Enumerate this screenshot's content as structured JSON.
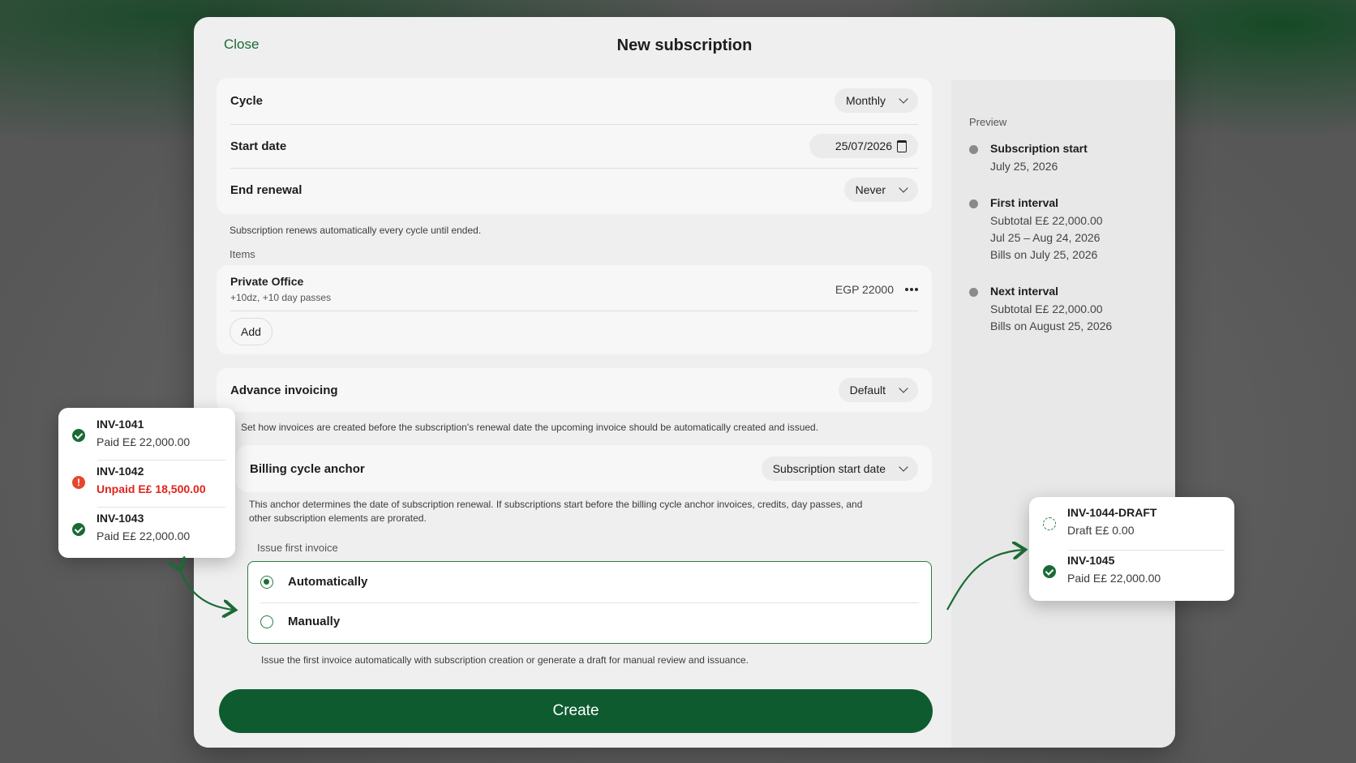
{
  "modal": {
    "close_label": "Close",
    "title": "New subscription"
  },
  "cycle": {
    "label": "Cycle",
    "value": "Monthly"
  },
  "start_date": {
    "label": "Start date",
    "value": "25/07/2026"
  },
  "end_renewal": {
    "label": "End renewal",
    "value": "Never"
  },
  "renewal_helper": "Subscription renews automatically every cycle until ended.",
  "items": {
    "section_label": "Items",
    "list": [
      {
        "name": "Private Office",
        "details": "+10dz, +10 day passes",
        "price": "EGP 22000"
      }
    ],
    "add_label": "Add"
  },
  "advance_invoicing": {
    "label": "Advance invoicing",
    "value": "Default",
    "helper": "Set how invoices are created before the subscription's renewal date the upcoming invoice should be automatically created and issued."
  },
  "billing_anchor": {
    "label": "Billing cycle anchor",
    "value": "Subscription start date",
    "helper": "This anchor determines the date of subscription renewal. If subscriptions start before the billing cycle anchor invoices, credits, day passes, and other subscription elements are prorated."
  },
  "issue_first_invoice": {
    "label": "Issue first invoice",
    "options": [
      "Automatically",
      "Manually"
    ],
    "selected": "Automatically",
    "helper": "Issue the first invoice automatically with subscription creation or generate a draft for manual review and issuance."
  },
  "create_label": "Create",
  "preview": {
    "label": "Preview",
    "timeline": [
      {
        "title": "Subscription start",
        "lines": [
          "July 25, 2026"
        ]
      },
      {
        "title": "First interval",
        "lines": [
          "Subtotal E£ 22,000.00",
          "Jul 25 – Aug 24, 2026",
          "Bills on July 25, 2026"
        ]
      },
      {
        "title": "Next interval",
        "lines": [
          "Subtotal E£ 22,000.00",
          "Bills on August 25, 2026"
        ]
      }
    ]
  },
  "invoices_left": [
    {
      "id": "INV-1041",
      "status": "Paid E£ 22,000.00",
      "state": "paid"
    },
    {
      "id": "INV-1042",
      "status": "Unpaid E£ 18,500.00",
      "state": "unpaid"
    },
    {
      "id": "INV-1043",
      "status": "Paid E£ 22,000.00",
      "state": "paid"
    }
  ],
  "invoices_right": [
    {
      "id": "INV-1044-DRAFT",
      "status": "Draft E£ 0.00",
      "state": "draft"
    },
    {
      "id": "INV-1045",
      "status": "Paid E£ 22,000.00",
      "state": "paid"
    }
  ],
  "colors": {
    "accent": "#0f5b30",
    "error": "#e0241b"
  }
}
